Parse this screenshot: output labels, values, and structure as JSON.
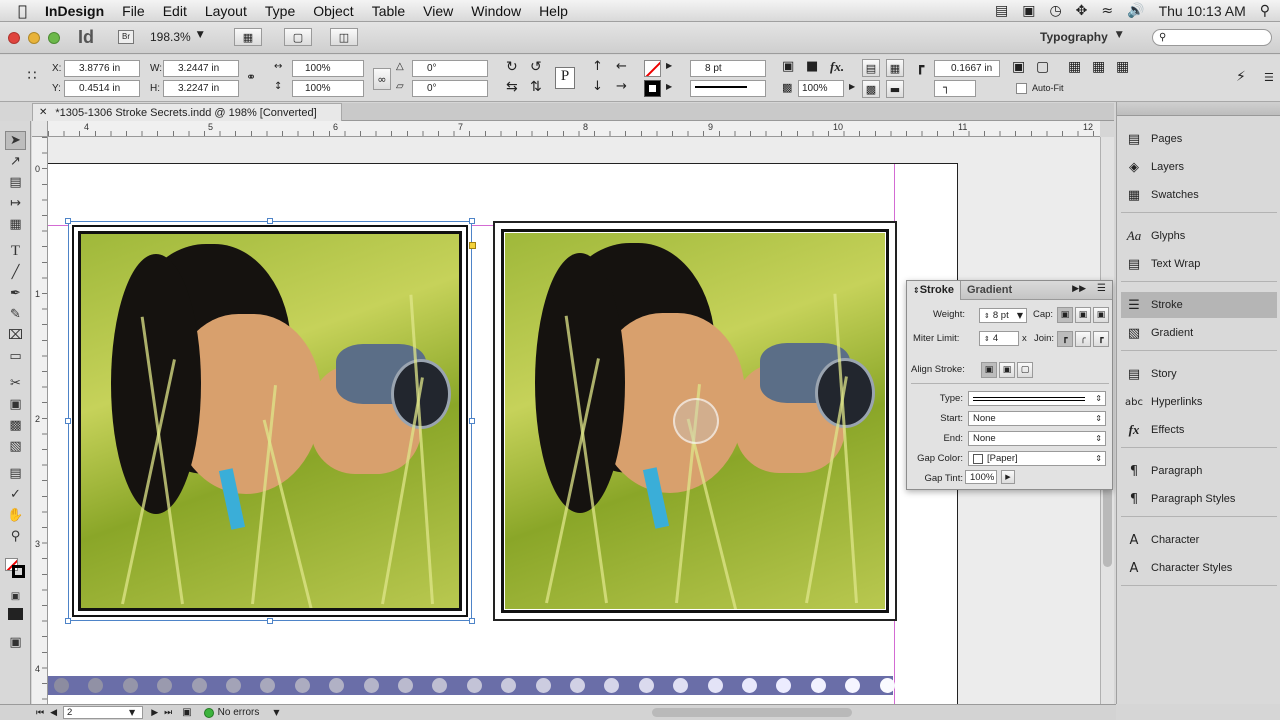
{
  "menubar": {
    "apple": "",
    "items": [
      "InDesign",
      "File",
      "Edit",
      "Layout",
      "Type",
      "Object",
      "Table",
      "View",
      "Window",
      "Help"
    ],
    "clock": "Thu 10:13 AM"
  },
  "appbar": {
    "logo": "Id",
    "bridge": "Br",
    "zoom": "198.3%",
    "workspace": "Typography"
  },
  "control": {
    "x_label": "X:",
    "x_value": "3.8776 in",
    "y_label": "Y:",
    "y_value": "0.4514 in",
    "w_label": "W:",
    "w_value": "3.2447 in",
    "h_label": "H:",
    "h_value": "3.2247 in",
    "scale_x": "100%",
    "scale_y": "100%",
    "rotate": "0°",
    "shear": "0°",
    "stroke_weight": "8 pt",
    "opacity": "100%",
    "fit_offset": "0.1667 in",
    "autofit": "Auto-Fit"
  },
  "document": {
    "tab_title": "*1305-1306 Stroke Secrets.indd @ 198% [Converted]",
    "h_ticks": [
      "4",
      "5",
      "6",
      "7",
      "8",
      "9",
      "10",
      "11",
      "12"
    ],
    "v_ticks": [
      "0",
      "1",
      "2",
      "3",
      "4"
    ]
  },
  "stroke_panel": {
    "tab_stroke": "Stroke",
    "tab_gradient": "Gradient",
    "weight_label": "Weight:",
    "weight_value": "8 pt",
    "cap_label": "Cap:",
    "miter_label": "Miter Limit:",
    "miter_value": "4",
    "miter_x": "x",
    "join_label": "Join:",
    "align_label": "Align Stroke:",
    "type_label": "Type:",
    "start_label": "Start:",
    "start_value": "None",
    "end_label": "End:",
    "end_value": "None",
    "gapcolor_label": "Gap Color:",
    "gapcolor_value": "[Paper]",
    "gaptint_label": "Gap Tint:",
    "gaptint_value": "100%"
  },
  "panels": [
    {
      "label": "Pages",
      "icon": "pages-icon"
    },
    {
      "label": "Layers",
      "icon": "layers-icon"
    },
    {
      "label": "Swatches",
      "icon": "swatches-icon"
    },
    {
      "label": "Glyphs",
      "icon": "glyphs-icon"
    },
    {
      "label": "Text Wrap",
      "icon": "text-wrap-icon"
    },
    {
      "label": "Stroke",
      "icon": "stroke-icon"
    },
    {
      "label": "Gradient",
      "icon": "gradient-icon"
    },
    {
      "label": "Story",
      "icon": "story-icon"
    },
    {
      "label": "Hyperlinks",
      "icon": "hyperlinks-icon"
    },
    {
      "label": "Effects",
      "icon": "effects-icon"
    },
    {
      "label": "Paragraph",
      "icon": "paragraph-icon"
    },
    {
      "label": "Paragraph Styles",
      "icon": "paragraph-styles-icon"
    },
    {
      "label": "Character",
      "icon": "character-icon"
    },
    {
      "label": "Character Styles",
      "icon": "character-styles-icon"
    }
  ],
  "status": {
    "page": "2",
    "preflight": "No errors"
  }
}
